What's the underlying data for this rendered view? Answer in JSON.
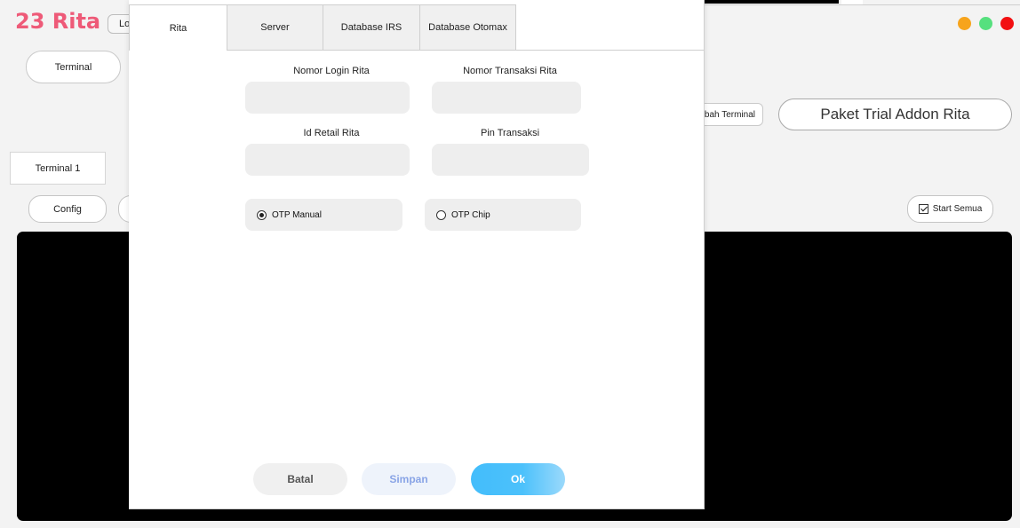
{
  "app": {
    "title": "23 Rita",
    "top_button_partial": "Lo",
    "window_controls": {
      "minimize_color": "#f7a41c",
      "maximize_color": "#56e07e",
      "close_color": "#f20f11"
    }
  },
  "background": {
    "terminal_button": "Terminal",
    "tambah_terminal_partial": "nbah Terminal",
    "paket_button": "Paket Trial Addon Rita",
    "terminal_tab": "Terminal 1",
    "config_button": "Config",
    "start_semua_label": "Start Semua",
    "start_semua_checked": true
  },
  "dialog": {
    "tabs": [
      {
        "label": "Rita",
        "active": true
      },
      {
        "label": "Server",
        "active": false
      },
      {
        "label": "Database IRS",
        "active": false
      },
      {
        "label": "Database Otomax",
        "active": false
      }
    ],
    "fields": {
      "nomor_login": {
        "label": "Nomor Login Rita",
        "value": ""
      },
      "nomor_transaksi": {
        "label": "Nomor Transaksi Rita",
        "value": ""
      },
      "id_retail": {
        "label": "Id Retail Rita",
        "value": ""
      },
      "pin_transaksi": {
        "label": "Pin Transaksi",
        "value": ""
      }
    },
    "otp": {
      "manual_label": "OTP Manual",
      "chip_label": "OTP Chip",
      "selected": "manual"
    },
    "buttons": {
      "batal": "Batal",
      "simpan": "Simpan",
      "ok": "Ok"
    }
  }
}
